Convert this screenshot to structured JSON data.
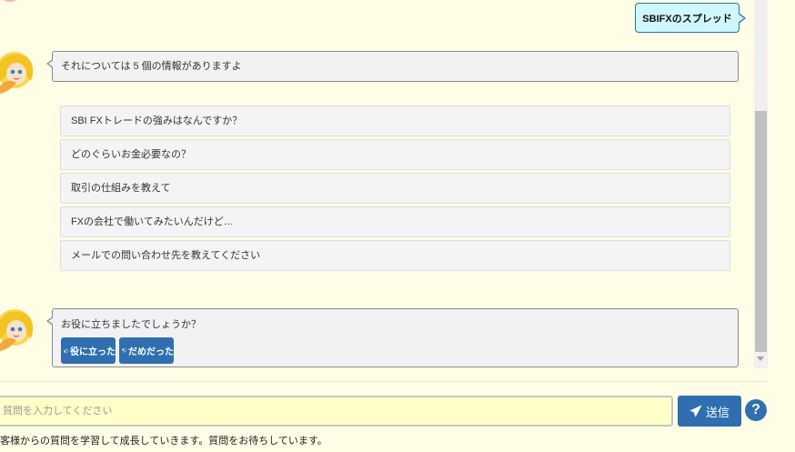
{
  "conversation": {
    "user_message": "SBIFXのスプレッド",
    "bot_reply": "それについては 5 個の情報がありますよ",
    "suggestions": [
      "SBI FXトレードの強みはなんですか？",
      "どのぐらいお金必要なの？",
      "取引の仕組みを教えて",
      "FXの会社で働いてみたいんだけど…",
      "メールでの問い合わせ先を教えてください"
    ],
    "feedback_question": "お役に立ちましたでしょうか？",
    "helpful_label": "役に立った",
    "not_helpful_label": "だめだった"
  },
  "input": {
    "placeholder": "質問を入力してください",
    "value": ""
  },
  "send_label": "送信",
  "help_label": "?",
  "footer_note": "客様からの質問を学習して成長していきます。質問をお待ちしています。",
  "colors": {
    "background": "#fffde6",
    "accent": "#2f6fb0",
    "user_bubble": "#cff7ff",
    "bot_bubble": "#f2f2f4",
    "input_bg": "#ffffc8"
  },
  "icons": {
    "thumbs_up": "thumbs-up-icon",
    "thumbs_down": "thumbs-down-icon",
    "send": "paper-plane-icon",
    "help": "question-circle-icon"
  }
}
